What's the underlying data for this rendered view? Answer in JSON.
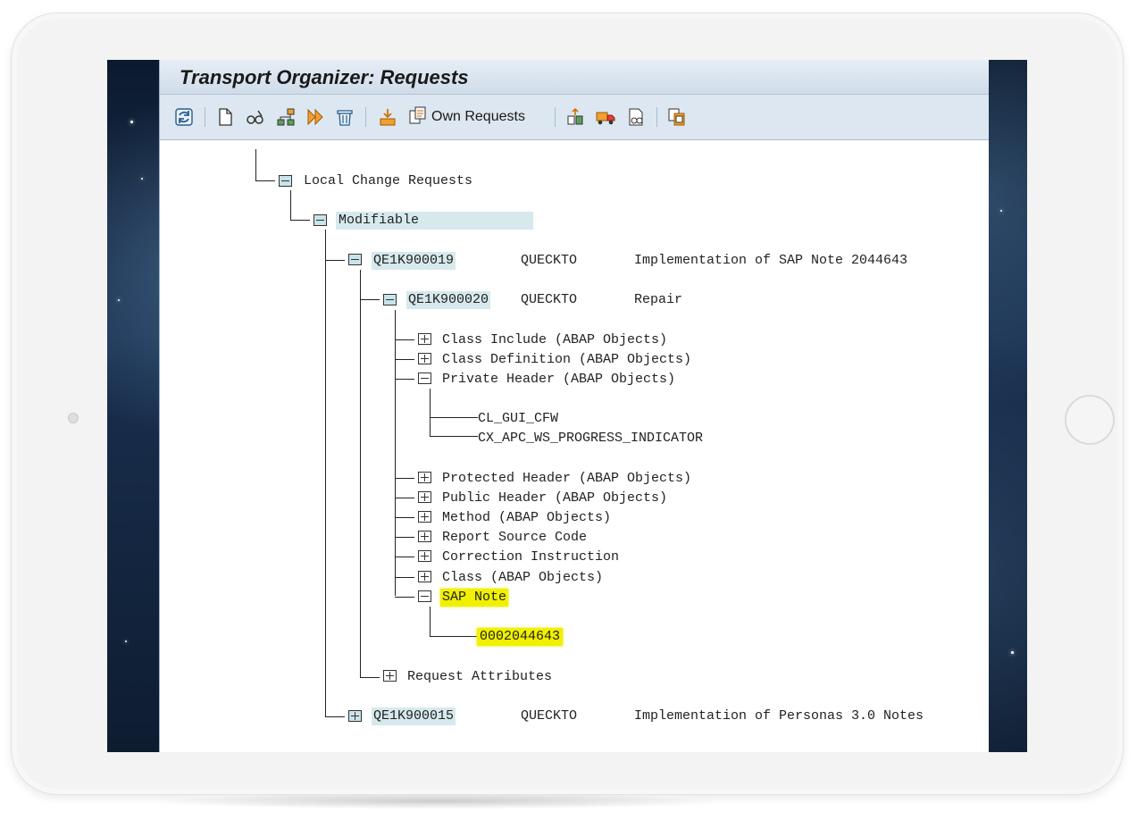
{
  "window": {
    "title": "Transport Organizer: Requests"
  },
  "toolbar": {
    "own_requests_label": "Own Requests",
    "icons": [
      "refresh-icon",
      "new-document-icon",
      "display-change-icon",
      "hierarchy-icon",
      "release-icon",
      "delete-icon",
      "import-icon",
      "own-requests-icon",
      "include-objects-icon",
      "transport-icon",
      "log-icon",
      "copy-icon"
    ]
  },
  "tree": {
    "local_change_requests": "Local Change Requests",
    "modifiable": "Modifiable",
    "request1": {
      "id": "QE1K900019",
      "owner": "QUECKTO",
      "description": "Implementation of SAP Note 2044643"
    },
    "task1": {
      "id": "QE1K900020",
      "owner": "QUECKTO",
      "description": "Repair"
    },
    "objects": [
      "Class Include (ABAP Objects)",
      "Class Definition (ABAP Objects)",
      "Private Header (ABAP Objects)"
    ],
    "private_header_children": [
      "CL_GUI_CFW",
      "CX_APC_WS_PROGRESS_INDICATOR"
    ],
    "objects2": [
      "Protected Header (ABAP Objects)",
      "Public Header (ABAP Objects)",
      "Method (ABAP Objects)",
      "Report Source Code",
      "Correction Instruction",
      "Class (ABAP Objects)",
      "SAP Note"
    ],
    "sap_note_child": "0002044643",
    "request_attributes": "Request Attributes",
    "request2": {
      "id": "QE1K900015",
      "owner": "QUECKTO",
      "description": "Implementation of Personas 3.0 Notes"
    }
  }
}
